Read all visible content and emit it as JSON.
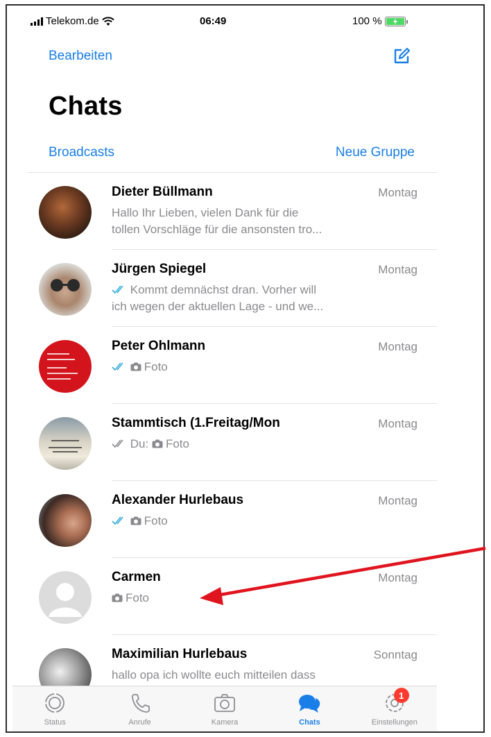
{
  "status_bar": {
    "carrier": "Telekom.de",
    "time": "06:49",
    "battery": "100 %"
  },
  "header": {
    "edit_label": "Bearbeiten",
    "title": "Chats",
    "broadcasts_label": "Broadcasts",
    "new_group_label": "Neue Gruppe"
  },
  "chats": [
    {
      "name": "Dieter Büllmann",
      "date": "Montag",
      "preview_line1": "Hallo Ihr Lieben, vielen Dank für die",
      "preview_line2": "tollen Vorschläge für die ansonsten tro..."
    },
    {
      "name": "Jürgen Spiegel",
      "date": "Montag",
      "preview_line1": "Kommt demnächst dran. Vorher will",
      "preview_line2": "ich wegen der aktuellen Lage - und we..."
    },
    {
      "name": "Peter Ohlmann",
      "date": "Montag",
      "preview": "Foto"
    },
    {
      "name": "Stammtisch (1.Freitag/Mon",
      "date": "Montag",
      "prefix": "Du:",
      "preview": "Foto"
    },
    {
      "name": "Alexander Hurlebaus",
      "date": "Montag",
      "preview": "Foto"
    },
    {
      "name": "Carmen",
      "date": "Montag",
      "preview": "Foto"
    },
    {
      "name": "Maximilian Hurlebaus",
      "date": "Sonntag",
      "preview_line1": "hallo opa  ich wollte euch mitteilen dass"
    }
  ],
  "tabs": [
    {
      "label": "Status",
      "icon": "status-icon"
    },
    {
      "label": "Anrufe",
      "icon": "phone-icon"
    },
    {
      "label": "Kamera",
      "icon": "camera-icon"
    },
    {
      "label": "Chats",
      "icon": "chats-icon"
    },
    {
      "label": "Einstellungen",
      "icon": "gear-icon",
      "badge": "1"
    }
  ],
  "colors": {
    "accent": "#1a7ee8",
    "secondary_text": "#8a8a8e",
    "badge": "#ff3b30",
    "arrow": "#e0141e"
  }
}
